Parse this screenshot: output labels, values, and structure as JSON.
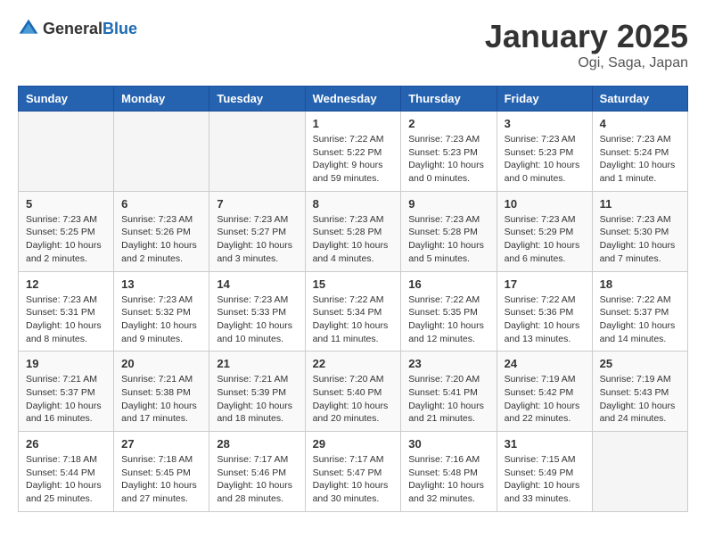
{
  "header": {
    "logo_general": "General",
    "logo_blue": "Blue",
    "month_title": "January 2025",
    "location": "Ogi, Saga, Japan"
  },
  "weekdays": [
    "Sunday",
    "Monday",
    "Tuesday",
    "Wednesday",
    "Thursday",
    "Friday",
    "Saturday"
  ],
  "weeks": [
    [
      {
        "day": "",
        "info": ""
      },
      {
        "day": "",
        "info": ""
      },
      {
        "day": "",
        "info": ""
      },
      {
        "day": "1",
        "info": "Sunrise: 7:22 AM\nSunset: 5:22 PM\nDaylight: 9 hours and 59 minutes."
      },
      {
        "day": "2",
        "info": "Sunrise: 7:23 AM\nSunset: 5:23 PM\nDaylight: 10 hours and 0 minutes."
      },
      {
        "day": "3",
        "info": "Sunrise: 7:23 AM\nSunset: 5:23 PM\nDaylight: 10 hours and 0 minutes."
      },
      {
        "day": "4",
        "info": "Sunrise: 7:23 AM\nSunset: 5:24 PM\nDaylight: 10 hours and 1 minute."
      }
    ],
    [
      {
        "day": "5",
        "info": "Sunrise: 7:23 AM\nSunset: 5:25 PM\nDaylight: 10 hours and 2 minutes."
      },
      {
        "day": "6",
        "info": "Sunrise: 7:23 AM\nSunset: 5:26 PM\nDaylight: 10 hours and 2 minutes."
      },
      {
        "day": "7",
        "info": "Sunrise: 7:23 AM\nSunset: 5:27 PM\nDaylight: 10 hours and 3 minutes."
      },
      {
        "day": "8",
        "info": "Sunrise: 7:23 AM\nSunset: 5:28 PM\nDaylight: 10 hours and 4 minutes."
      },
      {
        "day": "9",
        "info": "Sunrise: 7:23 AM\nSunset: 5:28 PM\nDaylight: 10 hours and 5 minutes."
      },
      {
        "day": "10",
        "info": "Sunrise: 7:23 AM\nSunset: 5:29 PM\nDaylight: 10 hours and 6 minutes."
      },
      {
        "day": "11",
        "info": "Sunrise: 7:23 AM\nSunset: 5:30 PM\nDaylight: 10 hours and 7 minutes."
      }
    ],
    [
      {
        "day": "12",
        "info": "Sunrise: 7:23 AM\nSunset: 5:31 PM\nDaylight: 10 hours and 8 minutes."
      },
      {
        "day": "13",
        "info": "Sunrise: 7:23 AM\nSunset: 5:32 PM\nDaylight: 10 hours and 9 minutes."
      },
      {
        "day": "14",
        "info": "Sunrise: 7:23 AM\nSunset: 5:33 PM\nDaylight: 10 hours and 10 minutes."
      },
      {
        "day": "15",
        "info": "Sunrise: 7:22 AM\nSunset: 5:34 PM\nDaylight: 10 hours and 11 minutes."
      },
      {
        "day": "16",
        "info": "Sunrise: 7:22 AM\nSunset: 5:35 PM\nDaylight: 10 hours and 12 minutes."
      },
      {
        "day": "17",
        "info": "Sunrise: 7:22 AM\nSunset: 5:36 PM\nDaylight: 10 hours and 13 minutes."
      },
      {
        "day": "18",
        "info": "Sunrise: 7:22 AM\nSunset: 5:37 PM\nDaylight: 10 hours and 14 minutes."
      }
    ],
    [
      {
        "day": "19",
        "info": "Sunrise: 7:21 AM\nSunset: 5:37 PM\nDaylight: 10 hours and 16 minutes."
      },
      {
        "day": "20",
        "info": "Sunrise: 7:21 AM\nSunset: 5:38 PM\nDaylight: 10 hours and 17 minutes."
      },
      {
        "day": "21",
        "info": "Sunrise: 7:21 AM\nSunset: 5:39 PM\nDaylight: 10 hours and 18 minutes."
      },
      {
        "day": "22",
        "info": "Sunrise: 7:20 AM\nSunset: 5:40 PM\nDaylight: 10 hours and 20 minutes."
      },
      {
        "day": "23",
        "info": "Sunrise: 7:20 AM\nSunset: 5:41 PM\nDaylight: 10 hours and 21 minutes."
      },
      {
        "day": "24",
        "info": "Sunrise: 7:19 AM\nSunset: 5:42 PM\nDaylight: 10 hours and 22 minutes."
      },
      {
        "day": "25",
        "info": "Sunrise: 7:19 AM\nSunset: 5:43 PM\nDaylight: 10 hours and 24 minutes."
      }
    ],
    [
      {
        "day": "26",
        "info": "Sunrise: 7:18 AM\nSunset: 5:44 PM\nDaylight: 10 hours and 25 minutes."
      },
      {
        "day": "27",
        "info": "Sunrise: 7:18 AM\nSunset: 5:45 PM\nDaylight: 10 hours and 27 minutes."
      },
      {
        "day": "28",
        "info": "Sunrise: 7:17 AM\nSunset: 5:46 PM\nDaylight: 10 hours and 28 minutes."
      },
      {
        "day": "29",
        "info": "Sunrise: 7:17 AM\nSunset: 5:47 PM\nDaylight: 10 hours and 30 minutes."
      },
      {
        "day": "30",
        "info": "Sunrise: 7:16 AM\nSunset: 5:48 PM\nDaylight: 10 hours and 32 minutes."
      },
      {
        "day": "31",
        "info": "Sunrise: 7:15 AM\nSunset: 5:49 PM\nDaylight: 10 hours and 33 minutes."
      },
      {
        "day": "",
        "info": ""
      }
    ]
  ]
}
